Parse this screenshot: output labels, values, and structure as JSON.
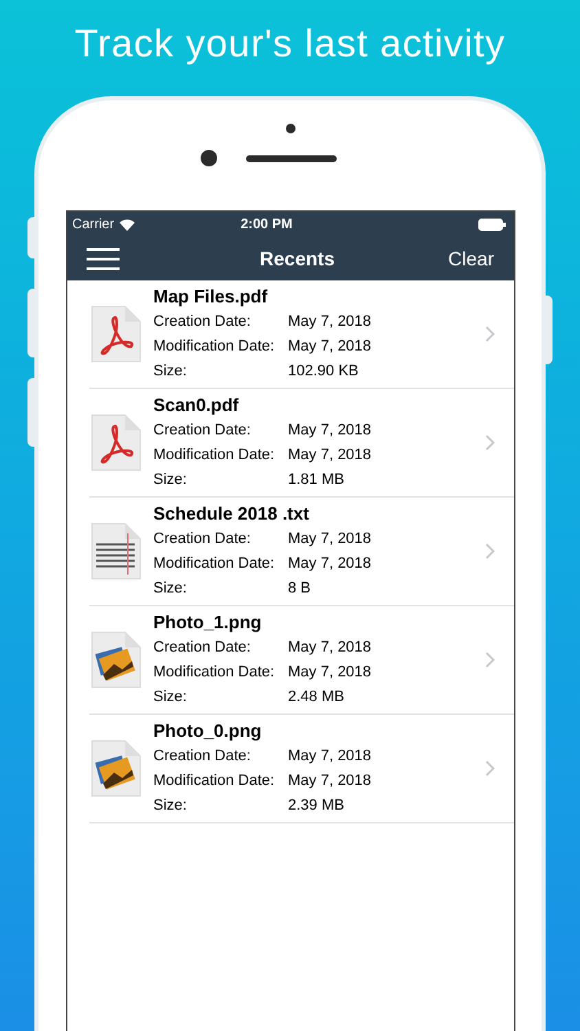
{
  "headline": "Track your's last activity",
  "status_bar": {
    "carrier": "Carrier",
    "time": "2:00 PM"
  },
  "nav": {
    "title": "Recents",
    "action": "Clear"
  },
  "files": [
    {
      "kind": "pdf",
      "name": "Map Files.pdf",
      "fields": [
        {
          "label": "Creation Date:",
          "value": "May 7, 2018"
        },
        {
          "label": "Modification Date:",
          "value": "May 7, 2018"
        },
        {
          "label": "Size:",
          "value": "102.90 KB"
        }
      ]
    },
    {
      "kind": "pdf",
      "name": "Scan0.pdf",
      "fields": [
        {
          "label": "Creation Date:",
          "value": "May 7, 2018"
        },
        {
          "label": "Modification Date:",
          "value": "May 7, 2018"
        },
        {
          "label": "Size:",
          "value": "1.81 MB"
        }
      ]
    },
    {
      "kind": "txt",
      "name": "Schedule 2018 .txt",
      "fields": [
        {
          "label": "Creation Date:",
          "value": "May 7, 2018"
        },
        {
          "label": "Modification Date:",
          "value": "May 7, 2018"
        },
        {
          "label": "Size:",
          "value": "8 B"
        }
      ]
    },
    {
      "kind": "image",
      "name": "Photo_1.png",
      "fields": [
        {
          "label": "Creation Date:",
          "value": "May 7, 2018"
        },
        {
          "label": "Modification Date:",
          "value": "May 7, 2018"
        },
        {
          "label": "Size:",
          "value": "2.48 MB"
        }
      ]
    },
    {
      "kind": "image",
      "name": "Photo_0.png",
      "fields": [
        {
          "label": "Creation Date:",
          "value": "May 7, 2018"
        },
        {
          "label": "Modification Date:",
          "value": "May 7, 2018"
        },
        {
          "label": "Size:",
          "value": "2.39 MB"
        }
      ]
    }
  ]
}
